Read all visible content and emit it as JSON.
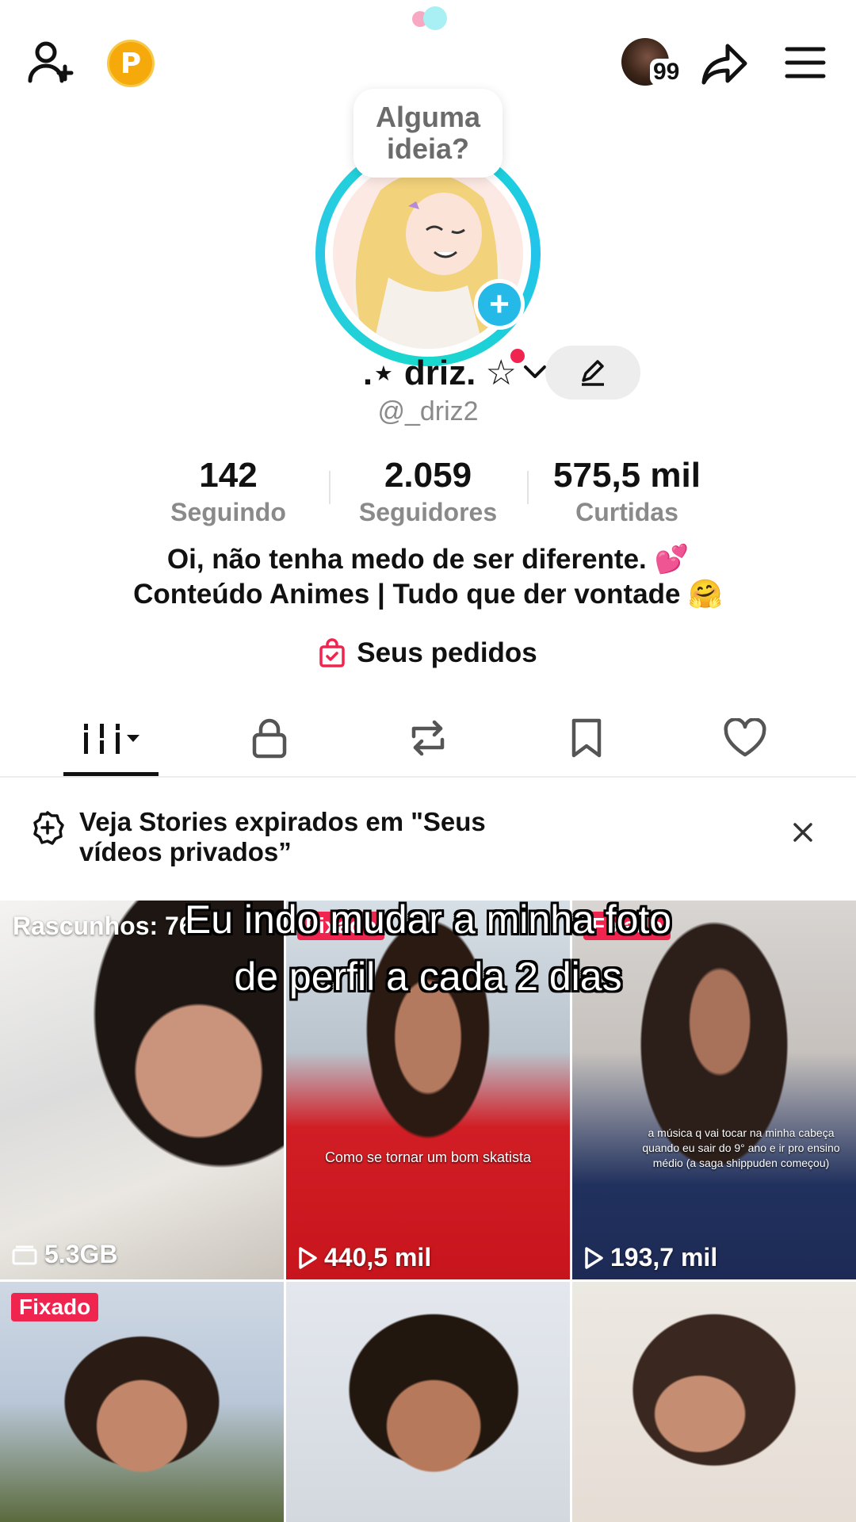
{
  "header": {
    "points_badge": "P",
    "notifications_count": "99"
  },
  "profile": {
    "idea_prompt": "Alguma ideia?",
    "display_name": ".⋆ driz. ☆",
    "username": "@_driz2"
  },
  "stats": [
    {
      "value": "142",
      "label": "Seguindo"
    },
    {
      "value": "2.059",
      "label": "Seguidores"
    },
    {
      "value": "575,5 mil",
      "label": "Curtidas"
    }
  ],
  "bio": {
    "line1": "Oi, não tenha medo de ser diferente. 💕",
    "line2": "Conteúdo Animes | Tudo que der vontade 🤗"
  },
  "orders_label": "Seus pedidos",
  "tabs": [
    "videos",
    "private",
    "reposts",
    "saved",
    "liked"
  ],
  "stories_banner": {
    "text": "Veja Stories expirados em \"Seus vídeos privados”"
  },
  "grid": {
    "tile1": {
      "label": "Rascunhos: 76",
      "size": "5.3GB"
    },
    "tile2": {
      "pinned": "Fixado",
      "caption": "Como se tornar um bom skatista",
      "views": "440,5 mil"
    },
    "tile3": {
      "pinned": "Fixado",
      "caption": "a música q vai tocar na minha cabeça quando eu sair do 9° ano e ir pro ensino médio (a saga shippuden começou)",
      "views": "193,7 mil"
    },
    "tile4": {
      "pinned": "Fixado"
    }
  },
  "overlay_caption": {
    "line1": "Eu indo mudar a minha foto",
    "line2": "de perfil a cada 2 dias"
  },
  "colors": {
    "accent_red": "#f0254f",
    "ring_cyan": "#18d9d1",
    "plus_blue": "#25b9e8",
    "points_gold": "#f5a90b"
  }
}
